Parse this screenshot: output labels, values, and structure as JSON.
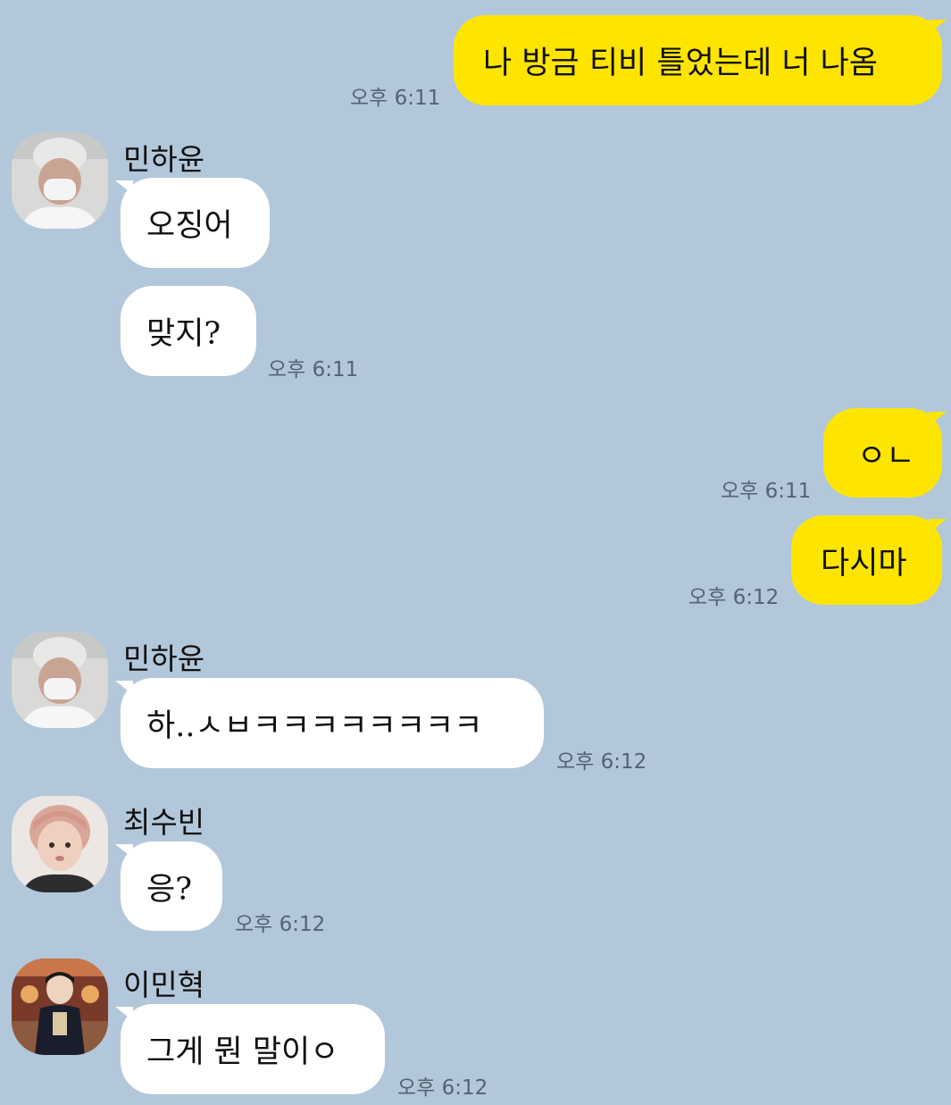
{
  "theme": {
    "background": "#b2c7da",
    "my_bubble": "#fee500",
    "their_bubble": "#ffffff",
    "time_color": "#556371"
  },
  "messages": [
    {
      "sender": "me",
      "text": "나 방금 티비 틀었는데 너 나옴",
      "time": "오후 6:11"
    },
    {
      "sender": "민하윤",
      "text": "오징어"
    },
    {
      "sender": "민하윤",
      "text": "맞지?",
      "time": "오후 6:11"
    },
    {
      "sender": "me",
      "text": "ㅇㄴ",
      "time": "오후 6:11"
    },
    {
      "sender": "me",
      "text": "다시마",
      "time": "오후 6:12"
    },
    {
      "sender": "민하윤",
      "text": "하..ㅅㅂㅋㅋㅋㅋㅋㅋㅋㅋ",
      "time": "오후 6:12"
    },
    {
      "sender": "최수빈",
      "text": "응?",
      "time": "오후 6:12"
    },
    {
      "sender": "이민혁",
      "text": "그게 뭔 말이ㅇ",
      "time": "오후 6:12"
    }
  ],
  "names": {
    "minhayun_1": "민하윤",
    "minhayun_2": "민하윤",
    "choisubin": "최수빈",
    "leeminhyuk": "이민혁"
  },
  "avatars": {
    "minhayun": "masked-person-avatar",
    "choisubin": "boy-portrait-avatar",
    "leeminhyuk": "man-in-dark-coat-avatar"
  }
}
